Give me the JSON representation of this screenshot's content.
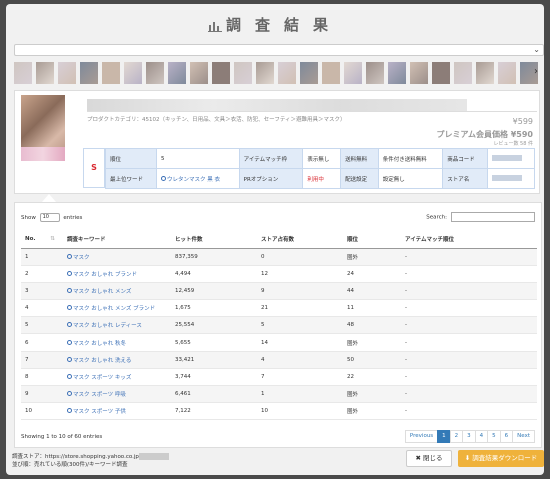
{
  "title": "調査結果",
  "colors": {
    "accent": "#337ab7",
    "warning": "#d9272e",
    "download": "#efb23b"
  },
  "product": {
    "category": "プロダクトカテゴリ：45102（キッチン、日用品、文具＞衣活、防犯、セーフティ＞避難用具＞マスク）",
    "price": "¥599",
    "premium_price": "プレミアム会員価格 ¥590",
    "review": "レビュー数 58 件",
    "rank_letter": "S",
    "info": {
      "row1": [
        "順位",
        "5",
        "アイテムマッチ枠",
        "表示無し",
        "送料無料",
        "条件付き送料無料",
        "商品コード"
      ],
      "row2": [
        "最上位ワード",
        "ウレタンマスク 黒 衣",
        "PRオプション",
        "利用中",
        "配送設定",
        "設定無し",
        "ストア名"
      ]
    }
  },
  "table": {
    "show_label": "Show",
    "entries_value": "10",
    "entries_label": "entries",
    "search_label": "Search:",
    "headers": [
      "No.",
      "調査キーワード",
      "ヒット件数",
      "ストア占有数",
      "順位",
      "アイテムマッチ順位"
    ],
    "rows": [
      [
        "1",
        "マスク",
        "837,359",
        "0",
        "圏外",
        "-"
      ],
      [
        "2",
        "マスク おしゃれ ブランド",
        "4,494",
        "12",
        "24",
        "-"
      ],
      [
        "3",
        "マスク おしゃれ メンズ",
        "12,459",
        "9",
        "44",
        "-"
      ],
      [
        "4",
        "マスク おしゃれ メンズ ブランド",
        "1,675",
        "21",
        "11",
        "-"
      ],
      [
        "5",
        "マスク おしゃれ レディース",
        "25,554",
        "5",
        "48",
        "-"
      ],
      [
        "6",
        "マスク おしゃれ 秋冬",
        "5,655",
        "14",
        "圏外",
        "-"
      ],
      [
        "7",
        "マスク おしゃれ 洗える",
        "33,421",
        "4",
        "50",
        "-"
      ],
      [
        "8",
        "マスク スポーツ キッズ",
        "3,744",
        "7",
        "22",
        "-"
      ],
      [
        "9",
        "マスク スポーツ 呼吸",
        "6,461",
        "1",
        "圏外",
        "-"
      ],
      [
        "10",
        "マスク スポーツ 子供",
        "7,122",
        "10",
        "圏外",
        "-"
      ]
    ],
    "footer_info": "Showing 1 to 10 of 60 entries",
    "pager": [
      "Previous",
      "1",
      "2",
      "3",
      "4",
      "5",
      "6",
      "Next"
    ]
  },
  "footer": {
    "store_label": "調査ストア：https://store.shopping.yahoo.co.jp",
    "sort_label": "並び順：売れている順(300件)/キーワード調査",
    "close_label": "閉じる",
    "download_label": "調査結果ダウンロード"
  }
}
